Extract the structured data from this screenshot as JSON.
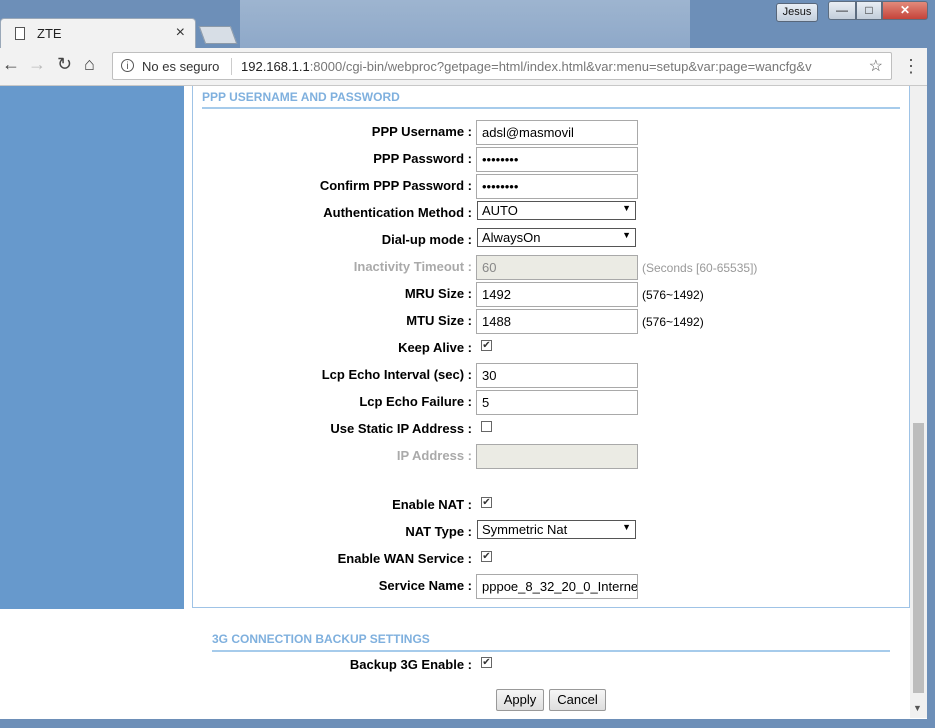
{
  "browser": {
    "tab_title": "ZTE",
    "tab_close": "×",
    "profile": "Jesus",
    "security": "No es seguro",
    "url_host": "192.168.1.1",
    "url_rest": ":8000/cgi-bin/webproc?getpage=html/index.html&var:menu=setup&var:page=wancfg&v"
  },
  "section": {
    "title": "PPP USERNAME AND PASSWORD"
  },
  "form": {
    "ppp_username": {
      "label": "PPP Username :",
      "value": "adsl@masmovil"
    },
    "ppp_password": {
      "label": "PPP Password :",
      "value": "••••••••"
    },
    "confirm_password": {
      "label": "Confirm PPP Password :",
      "value": "••••••••"
    },
    "auth_method": {
      "label": "Authentication Method :",
      "value": "AUTO"
    },
    "dialup_mode": {
      "label": "Dial-up mode :",
      "value": "AlwaysOn"
    },
    "inactivity_timeout": {
      "label": "Inactivity Timeout :",
      "value": "60",
      "hint": "(Seconds [60-65535])"
    },
    "mru_size": {
      "label": "MRU Size :",
      "value": "1492",
      "hint": "(576~1492)"
    },
    "mtu_size": {
      "label": "MTU Size :",
      "value": "1488",
      "hint": "(576~1492)"
    },
    "keep_alive": {
      "label": "Keep Alive :",
      "checked": true
    },
    "lcp_echo_interval": {
      "label": "Lcp Echo Interval (sec) :",
      "value": "30"
    },
    "lcp_echo_failure": {
      "label": "Lcp Echo Failure :",
      "value": "5"
    },
    "use_static_ip": {
      "label": "Use Static IP Address :",
      "checked": false
    },
    "ip_address": {
      "label": "IP Address :",
      "value": ""
    },
    "enable_nat": {
      "label": "Enable NAT :",
      "checked": true
    },
    "nat_type": {
      "label": "NAT Type :",
      "value": "Symmetric Nat"
    },
    "enable_wan": {
      "label": "Enable WAN Service :",
      "checked": true
    },
    "service_name": {
      "label": "Service Name :",
      "value": "pppoe_8_32_20_0_Interne"
    }
  },
  "backup": {
    "title": "3G CONNECTION BACKUP SETTINGS",
    "enable_label": "Backup 3G Enable :",
    "enabled": true
  },
  "buttons": {
    "apply": "Apply",
    "cancel": "Cancel"
  }
}
